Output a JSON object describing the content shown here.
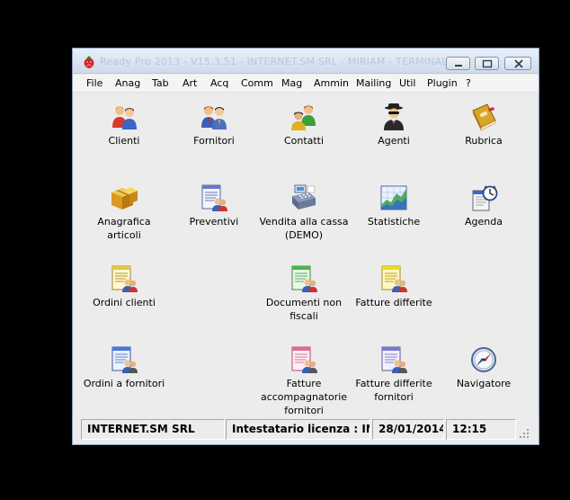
{
  "window": {
    "title": "Ready Pro 2013 - V15.3.51 - INTERNET.SM SRL - MIRIAM - TERMINALE",
    "buttons": [
      "minimize",
      "maximize",
      "close"
    ]
  },
  "menu": [
    "File",
    "Anag",
    "Tab",
    "Art",
    "Acq",
    "Comm",
    "Mag",
    "Ammin",
    "Mailing",
    "Util",
    "Plugin",
    "?"
  ],
  "tiles": [
    {
      "label": "Clienti",
      "icon": "clients-icon"
    },
    {
      "label": "Fornitori",
      "icon": "suppliers-icon"
    },
    {
      "label": "Contatti",
      "icon": "contacts-icon"
    },
    {
      "label": "Agenti",
      "icon": "agent-icon"
    },
    {
      "label": "Rubrica",
      "icon": "address-book-icon"
    },
    {
      "label": "Anagrafica articoli",
      "icon": "boxes-icon"
    },
    {
      "label": "Preventivi",
      "icon": "quote-document-icon"
    },
    {
      "label": "Vendita alla cassa\n(DEMO)",
      "icon": "cash-register-icon"
    },
    {
      "label": "Statistiche",
      "icon": "chart-icon"
    },
    {
      "label": "Agenda",
      "icon": "agenda-clock-icon"
    },
    {
      "label": "Ordini clienti",
      "icon": "client-orders-icon"
    },
    {
      "label": "Documenti non\nfiscali",
      "icon": "non-fiscal-documents-icon"
    },
    {
      "label": "Fatture differite",
      "icon": "deferred-invoices-icon"
    },
    {
      "label": "Ordini a fornitori",
      "icon": "supplier-orders-icon"
    },
    {
      "label": "Fatture\naccompagnatorie\nfornitori",
      "icon": "accompanying-invoices-icon"
    },
    {
      "label": "Fatture differite\nfornitori",
      "icon": "supplier-deferred-invoices-icon"
    },
    {
      "label": "Navigatore",
      "icon": "compass-icon"
    }
  ],
  "status": {
    "company": "INTERNET.SM SRL",
    "license": "Intestatario licenza : INTERNET.SM SRL",
    "date": "28/01/2014",
    "time": "12:15"
  },
  "colors": {
    "background": "#000000",
    "window": "#ececec",
    "title_text": "#b8c6d8"
  }
}
